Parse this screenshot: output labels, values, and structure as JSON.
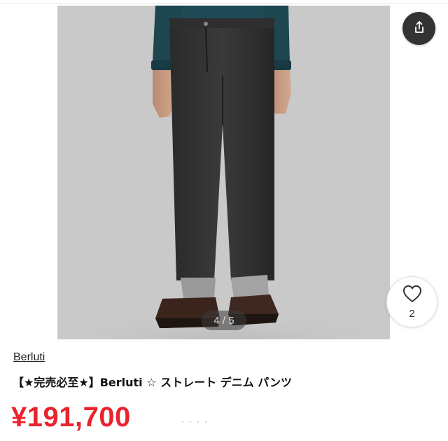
{
  "image": {
    "pager_text": "4 / 5",
    "current_index": 4,
    "total": 5
  },
  "actions": {
    "share_icon": "share-upload-icon",
    "like_icon": "heart-outline-icon",
    "like_count": "2"
  },
  "product": {
    "brand": "Berluti",
    "title": "【★完売必至★】Berluti ☆ ストレート デニム パンツ",
    "price": "¥191,700"
  },
  "colors": {
    "price": "#e8242e",
    "share_button_bg": "#333333",
    "image_bg": "#c8c8c8"
  }
}
